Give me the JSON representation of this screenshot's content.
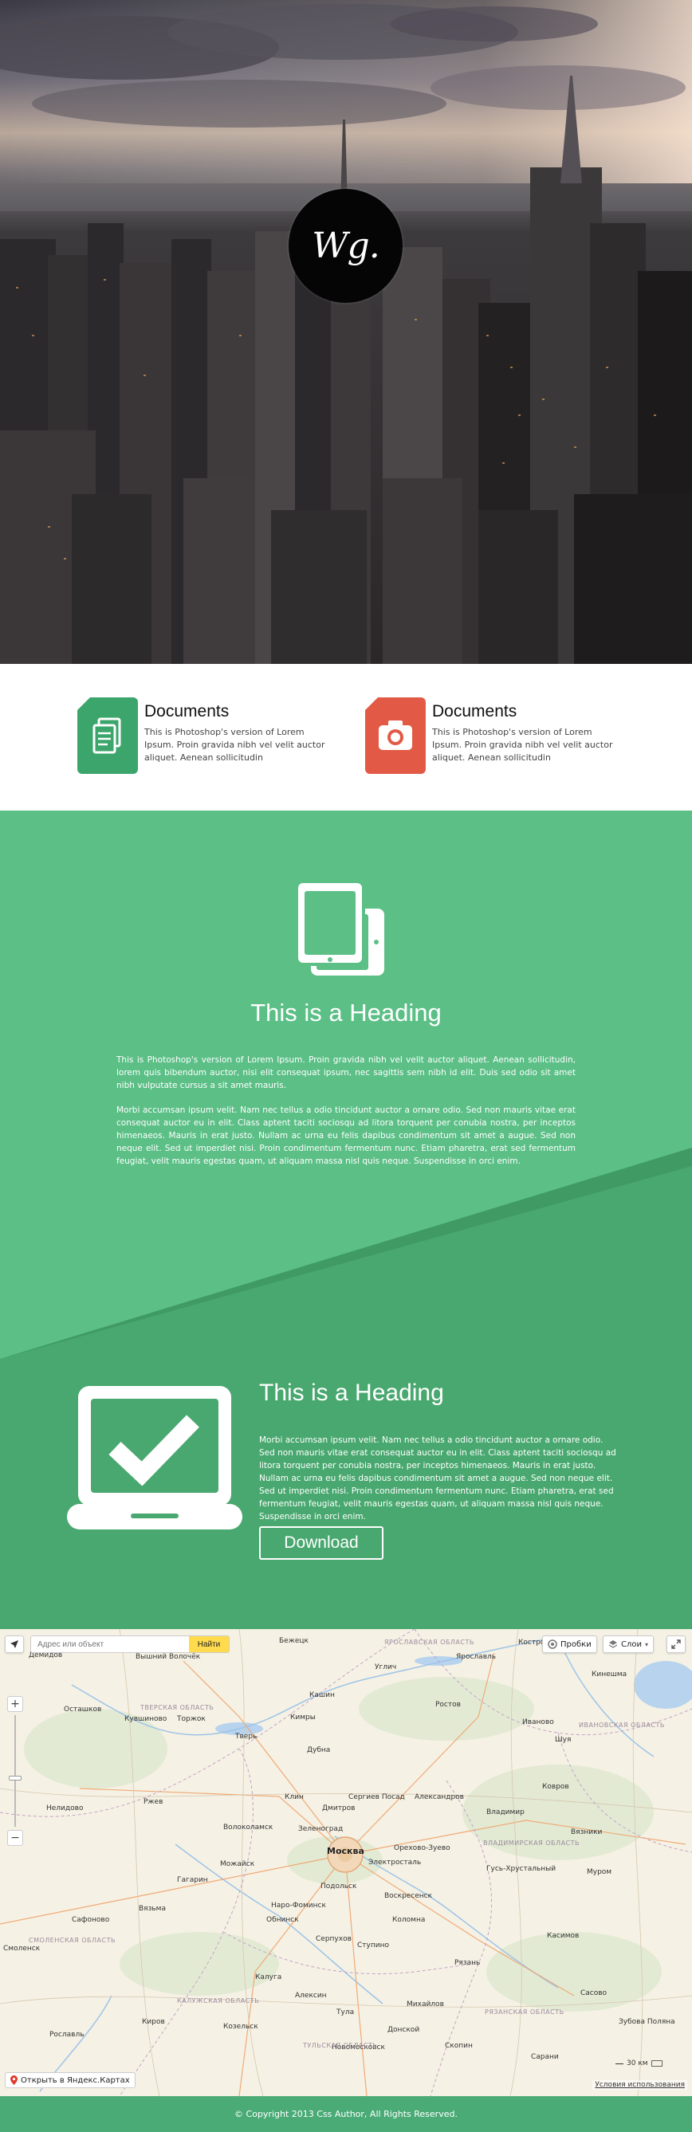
{
  "hero": {
    "logo_text": "Wg."
  },
  "features": [
    {
      "icon": "document-icon",
      "color": "#3ba56b",
      "title": "Documents",
      "text": "This is Photoshop's version of Lorem Ipsum. Proin gravida nibh vel velit auctor aliquet. Aenean sollicitudin"
    },
    {
      "icon": "camera-icon",
      "color": "#e25a45",
      "title": "Documents",
      "text": "This is Photoshop's version of Lorem Ipsum. Proin gravida nibh vel velit auctor aliquet. Aenean sollicitudin"
    }
  ],
  "section1": {
    "heading": "This is a Heading",
    "para1": "This is Photoshop's version of Lorem Ipsum. Proin gravida nibh vel velit auctor aliquet. Aenean sollicitudin, lorem quis bibendum auctor, nisi elit consequat ipsum, nec sagittis sem nibh id elit. Duis sed odio sit amet nibh vulputate cursus a sit amet mauris.",
    "para2": "Morbi accumsan ipsum velit. Nam nec tellus a odio tincidunt auctor a ornare odio. Sed non mauris vitae erat consequat auctor eu in elit. Class aptent taciti sociosqu ad litora torquent per conubia nostra, per inceptos himenaeos. Mauris in erat justo. Nullam ac urna eu felis dapibus condimentum sit amet a augue. Sed non neque elit. Sed ut imperdiet nisi. Proin condimentum fermentum nunc. Etiam pharetra, erat sed fermentum feugiat, velit mauris egestas quam, ut aliquam massa nisl quis neque. Suspendisse in orci enim."
  },
  "section2": {
    "heading": "This is a Heading",
    "para": "Morbi accumsan ipsum velit. Nam nec tellus a odio tincidunt auctor a ornare odio. Sed non mauris vitae erat consequat auctor eu in elit. Class aptent taciti sociosqu ad litora torquent per conubia nostra, per inceptos himenaeos. Mauris in erat justo. Nullam ac urna eu felis dapibus condimentum sit amet a augue. Sed non neque elit. Sed ut imperdiet nisi. Proin condimentum fermentum nunc. Etiam pharetra, erat sed fermentum feugiat, velit mauris egestas quam, ut aliquam massa nisl quis neque. Suspendisse in orci enim.",
    "button_label": "Download"
  },
  "map": {
    "search_placeholder": "Адрес или объект",
    "search_button": "Найти",
    "traffic_label": "Пробки",
    "layers_label": "Слои",
    "open_in_yandex": "Открыть в Яндекс.Картах",
    "terms": "Условия использования",
    "scale": "30 км",
    "cities": [
      {
        "name": "Москва",
        "big": true
      },
      {
        "name": "Тверь",
        "big": false
      },
      {
        "name": "Ярославль",
        "big": false
      },
      {
        "name": "Владимир",
        "big": false
      },
      {
        "name": "Иваново",
        "big": false
      },
      {
        "name": "Рязань",
        "big": false
      },
      {
        "name": "Тула",
        "big": false
      },
      {
        "name": "Калуга",
        "big": false
      },
      {
        "name": "Смоленск",
        "big": false
      },
      {
        "name": "Кострома",
        "big": false
      },
      {
        "name": "Ростов",
        "big": false
      },
      {
        "name": "Углич",
        "big": false
      },
      {
        "name": "Дубна",
        "big": false
      },
      {
        "name": "Клин",
        "big": false
      },
      {
        "name": "Сергиев Посад",
        "big": false
      },
      {
        "name": "Александров",
        "big": false
      },
      {
        "name": "Дмитров",
        "big": false
      },
      {
        "name": "Зеленоград",
        "big": false
      },
      {
        "name": "Орехово-Зуево",
        "big": false
      },
      {
        "name": "Электросталь",
        "big": false
      },
      {
        "name": "Подольск",
        "big": false
      },
      {
        "name": "Воскресенск",
        "big": false
      },
      {
        "name": "Серпухов",
        "big": false
      },
      {
        "name": "Ступино",
        "big": false
      },
      {
        "name": "Коломна",
        "big": false
      },
      {
        "name": "Обнинск",
        "big": false
      },
      {
        "name": "Наро-Фоминск",
        "big": false
      },
      {
        "name": "Можайск",
        "big": false
      },
      {
        "name": "Ржев",
        "big": false
      },
      {
        "name": "Вязьма",
        "big": false
      },
      {
        "name": "Гагарин",
        "big": false
      },
      {
        "name": "Сафоново",
        "big": false
      },
      {
        "name": "Торжок",
        "big": false
      },
      {
        "name": "Кимры",
        "big": false
      },
      {
        "name": "Кинешма",
        "big": false
      },
      {
        "name": "Шуя",
        "big": false
      },
      {
        "name": "Ковров",
        "big": false
      },
      {
        "name": "Муром",
        "big": false
      },
      {
        "name": "Касимов",
        "big": false
      },
      {
        "name": "Новомосковск",
        "big": false
      },
      {
        "name": "Волоколамск",
        "big": false
      },
      {
        "name": "Гусь-Хрустальный",
        "big": false
      },
      {
        "name": "Вышний Волочёк",
        "big": false
      },
      {
        "name": "Бежецк",
        "big": false
      },
      {
        "name": "Осташков",
        "big": false
      },
      {
        "name": "Нелидово",
        "big": false
      },
      {
        "name": "Рославль",
        "big": false
      },
      {
        "name": "Киров",
        "big": false
      },
      {
        "name": "Алексин",
        "big": false
      },
      {
        "name": "Михайлов",
        "big": false
      },
      {
        "name": "Скопин",
        "big": false
      },
      {
        "name": "Сасово",
        "big": false
      },
      {
        "name": "Вязники",
        "big": false
      },
      {
        "name": "Кашин",
        "big": false
      },
      {
        "name": "Кувшиново",
        "big": false
      },
      {
        "name": "Демидов",
        "big": false
      },
      {
        "name": "Козельск",
        "big": false
      },
      {
        "name": "Донской",
        "big": false
      },
      {
        "name": "Зубова Поляна",
        "big": false
      },
      {
        "name": "Сарани",
        "big": false
      }
    ],
    "regions": [
      "ТВЕРСКАЯ ОБЛАСТЬ",
      "ЯРОСЛАВСКАЯ ОБЛАСТЬ",
      "ИВАНОВСКАЯ ОБЛАСТЬ",
      "ВЛАДИМИРСКАЯ ОБЛАСТЬ",
      "СМОЛЕНСКАЯ ОБЛАСТЬ",
      "КАЛУЖСКАЯ ОБЛАСТЬ",
      "ТУЛЬСКАЯ ОБЛАСТЬ",
      "РЯЗАНСКАЯ ОБЛАСТЬ"
    ]
  },
  "footer": {
    "copyright": "© Copyright 2013 Css Author, All Rights Reserved."
  },
  "colors": {
    "green_light": "#5bbf86",
    "green_dark": "#4aab77",
    "accent_red": "#e25a45",
    "map_button_yellow": "#ffdb4d"
  }
}
